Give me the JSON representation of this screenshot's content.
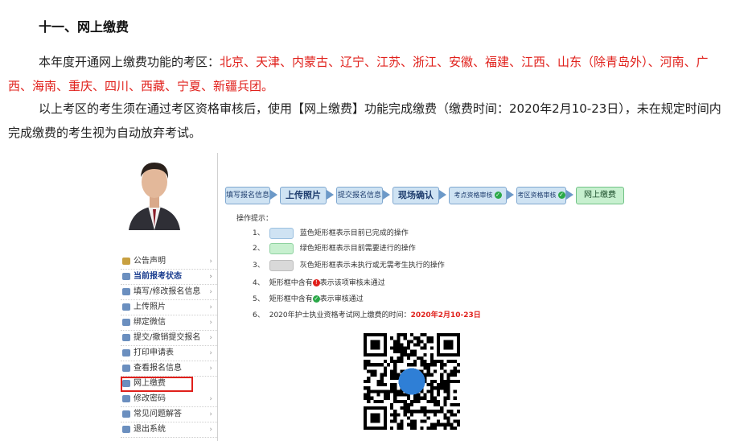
{
  "heading": "十一、网上缴费",
  "para1": {
    "prefix": "本年度开通网上缴费功能的考区：",
    "regions": "北京、天津、内蒙古、辽宁、江苏、浙江、安徽、福建、江西、山东（除青岛外）、河南、广西、海南、重庆、四川、西藏、宁夏、新疆兵团。"
  },
  "para2": "以上考区的考生须在通过考区资格审核后，使用【网上缴费】功能完成缴费（缴费时间：2020年2月10-23日），未在规定时间内完成缴费的考生视为自动放弃考试。",
  "screenshot": {
    "menu": [
      {
        "label": "公告声明",
        "icon": "home-icon"
      },
      {
        "label": "当前报考状态",
        "icon": "status-icon"
      },
      {
        "label": "填写/修改报名信息",
        "icon": "edit-icon"
      },
      {
        "label": "上传照片",
        "icon": "photo-icon"
      },
      {
        "label": "绑定微信",
        "icon": "wechat-icon"
      },
      {
        "label": "提交/撤销提交报名",
        "icon": "submit-icon"
      },
      {
        "label": "打印申请表",
        "icon": "print-icon"
      },
      {
        "label": "查看报名信息",
        "icon": "view-icon"
      },
      {
        "label": "网上缴费",
        "icon": "payment-icon"
      },
      {
        "label": "修改密码",
        "icon": "password-icon"
      },
      {
        "label": "常见问题解答",
        "icon": "faq-icon"
      },
      {
        "label": "退出系统",
        "icon": "logout-icon"
      }
    ],
    "steps": [
      "填写报名信息",
      "上传照片",
      "提交报名信息",
      "现场确认",
      "考点资格审核",
      "考区资格审核",
      "网上缴费"
    ],
    "tips_title": "操作提示：",
    "tips": [
      {
        "num": "1、",
        "text": "蓝色矩形框表示目前已完成的操作"
      },
      {
        "num": "2、",
        "text": "绿色矩形框表示目前需要进行的操作"
      },
      {
        "num": "3、",
        "text": "灰色矩形框表示未执行或无需考生执行的操作"
      },
      {
        "num": "4、",
        "pre": "矩形框中含有",
        "post": "表示该项审核未通过"
      },
      {
        "num": "5、",
        "pre": "矩形框中含有",
        "post": "表示审核通过"
      },
      {
        "num": "6、",
        "pre": "2020年护士执业资格考试网上缴费的时间：",
        "highlight": "2020年2月10-23日"
      }
    ],
    "colors": {
      "blue": "#cfe3f3",
      "green": "#c7f0cf",
      "gray": "#d9d9d9",
      "red": "#e0201b"
    }
  }
}
